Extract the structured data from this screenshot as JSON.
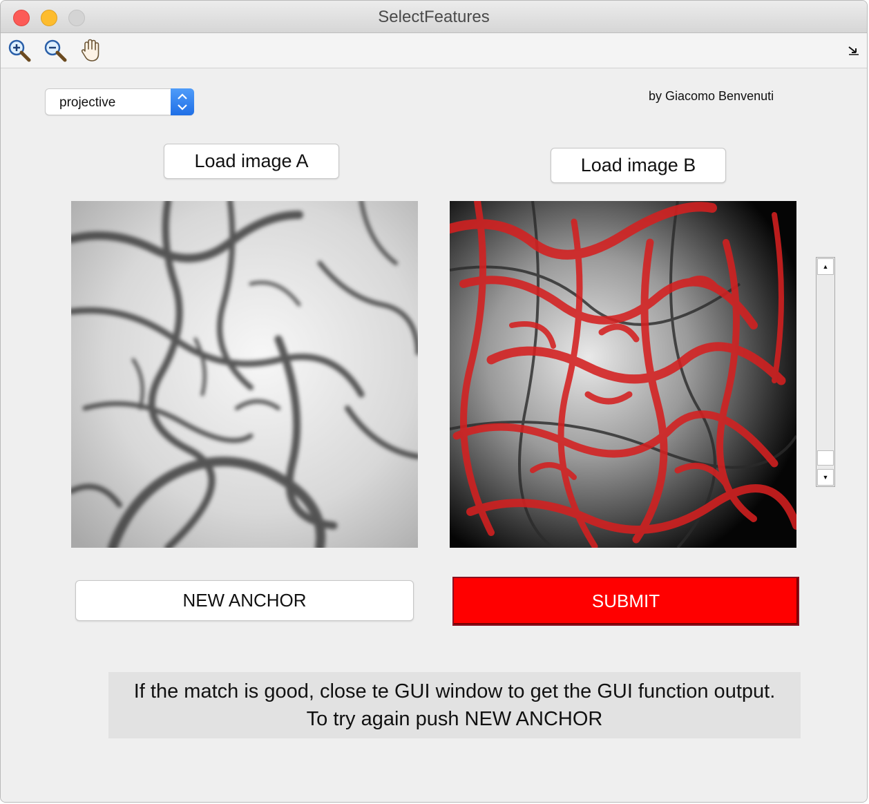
{
  "window": {
    "title": "SelectFeatures",
    "traffic_lights": [
      "close",
      "minimize",
      "zoom"
    ]
  },
  "toolbar": {
    "tools": [
      {
        "icon": "zoom-in-icon"
      },
      {
        "icon": "zoom-out-icon"
      },
      {
        "icon": "pan-hand-icon"
      }
    ],
    "dock_icon": "dock-arrow-icon"
  },
  "controls": {
    "transform_select": {
      "value": "projective"
    },
    "author": "by Giacomo Benvenuti",
    "load_a_label": "Load image A",
    "load_b_label": "Load image B",
    "new_anchor_label": "NEW ANCHOR",
    "submit_label": "SUBMIT",
    "submit_color": "#ff0000"
  },
  "images": {
    "a": {
      "description_icon": "grayscale-vessel-image"
    },
    "b": {
      "description_icon": "overlay-vessel-image",
      "overlay_color": "#d42020"
    }
  },
  "scrollbar": {
    "position": 0.92
  },
  "message": "If the match is good, close te GUI window to get the GUI function output. To try again push NEW ANCHOR"
}
